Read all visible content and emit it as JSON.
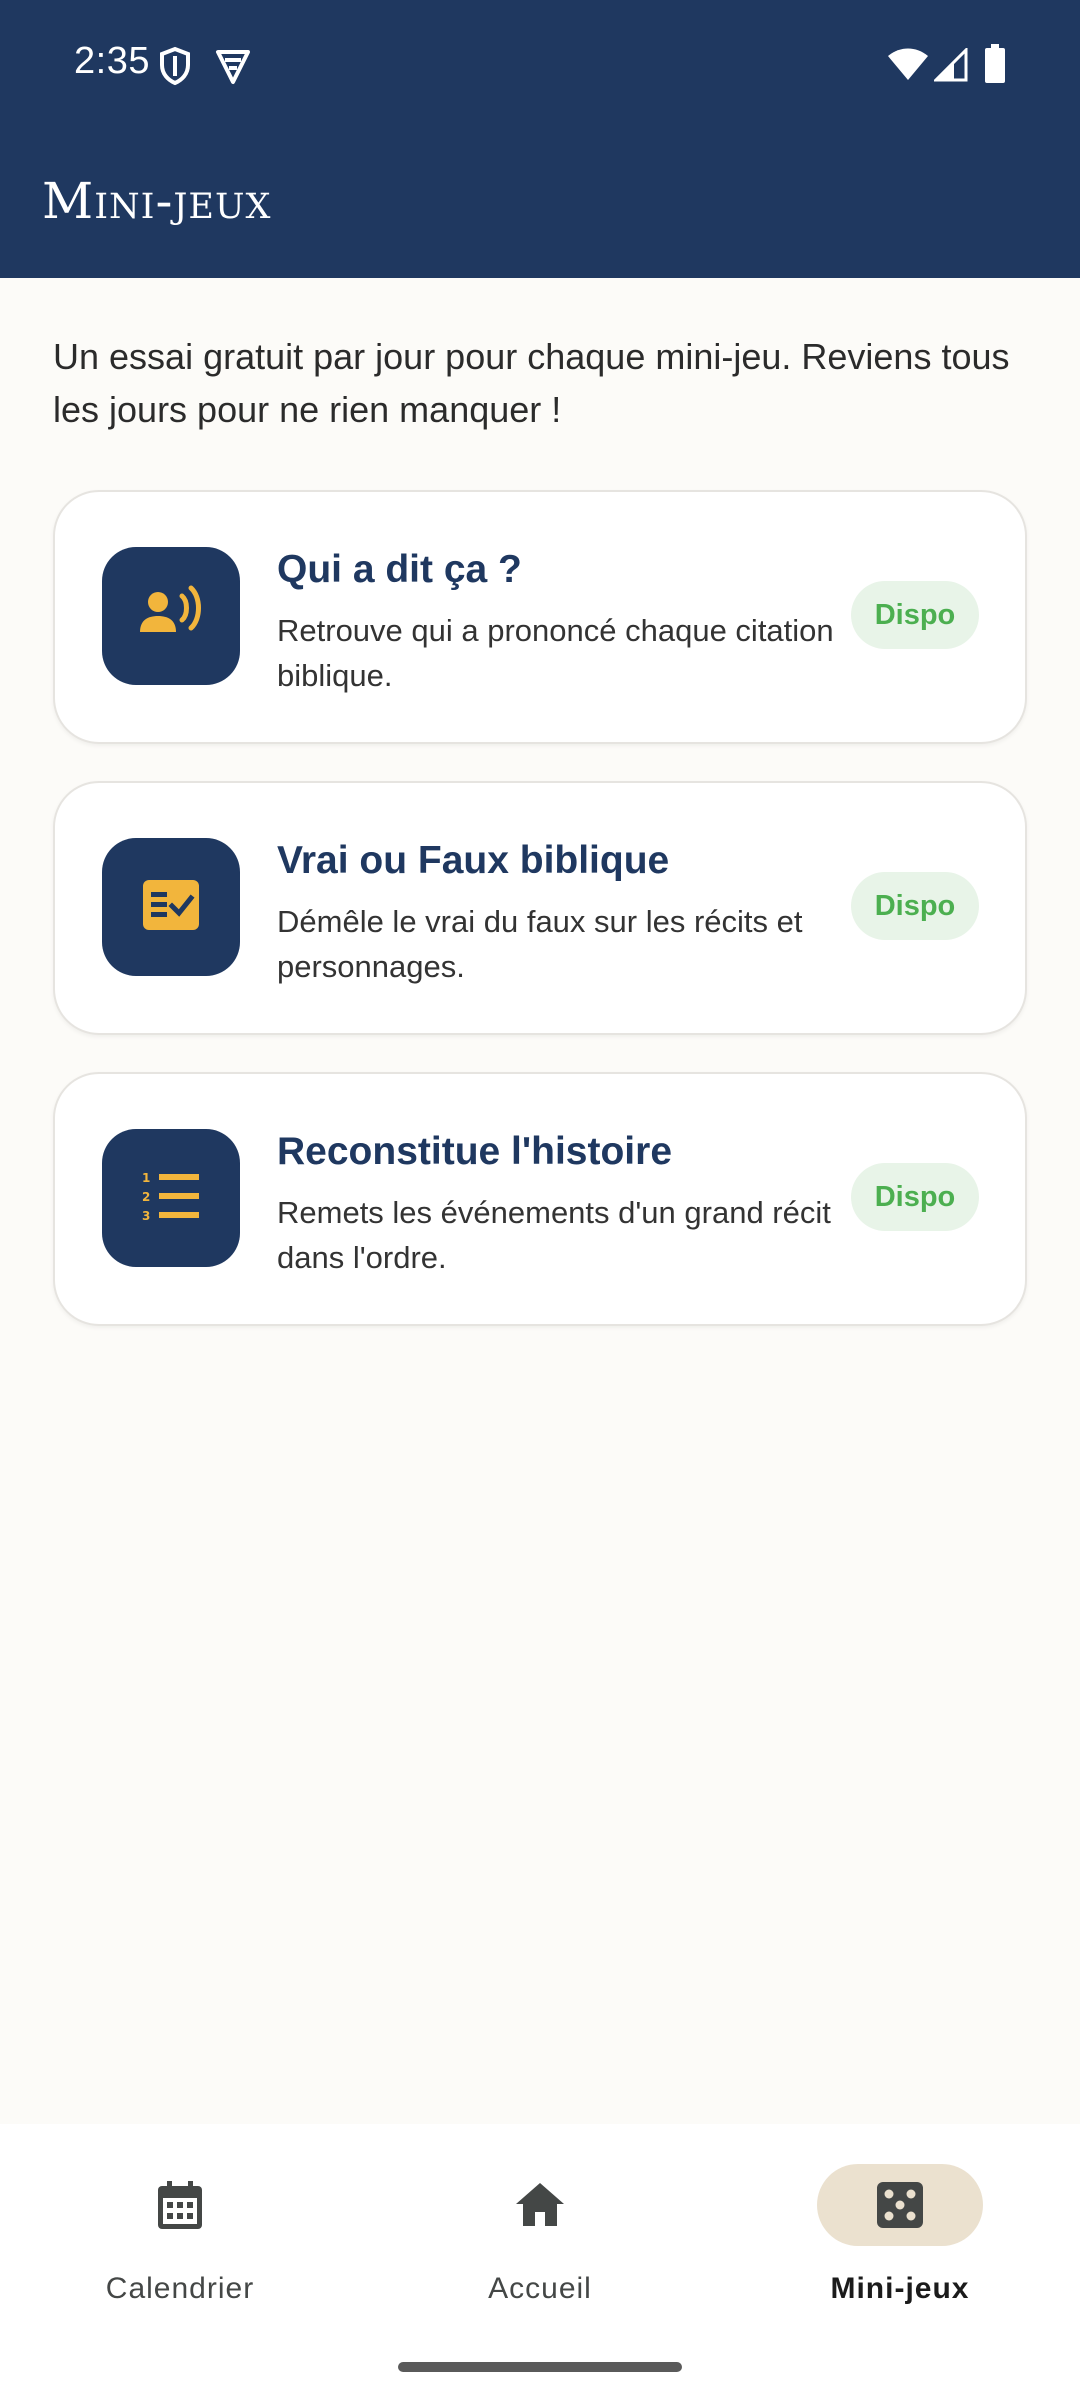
{
  "status_bar": {
    "time": "2:35",
    "icons": [
      "shield-icon",
      "vpn-icon",
      "wifi-icon",
      "signal-icon",
      "battery-icon"
    ]
  },
  "header": {
    "title": "Mini-jeux"
  },
  "intro": "Un essai gratuit par jour pour chaque mini-jeu. Reviens tous les jours pour ne rien manquer !",
  "games": [
    {
      "title": "Qui a dit ça ?",
      "description": "Retrouve qui a prononcé chaque citation biblique.",
      "badge": "Dispo",
      "icon": "speaker-person-icon"
    },
    {
      "title": "Vrai ou Faux biblique",
      "description": "Démêle le vrai du faux sur les récits et personnages.",
      "badge": "Dispo",
      "icon": "fact-check-icon"
    },
    {
      "title": "Reconstitue l'histoire",
      "description": "Remets les événements d'un grand récit dans l'ordre.",
      "badge": "Dispo",
      "icon": "numbered-list-icon"
    }
  ],
  "bottom_nav": {
    "items": [
      {
        "label": "Calendrier",
        "icon": "calendar-icon",
        "active": false
      },
      {
        "label": "Accueil",
        "icon": "home-icon",
        "active": false
      },
      {
        "label": "Mini-jeux",
        "icon": "dice-icon",
        "active": true
      }
    ]
  },
  "colors": {
    "primary": "#1f3860",
    "accent": "#f2b53c",
    "badge_bg": "#e8f4e8",
    "badge_text": "#4caf50",
    "background": "#fcfbf8",
    "nav_active_bg": "#ebe1cf"
  }
}
